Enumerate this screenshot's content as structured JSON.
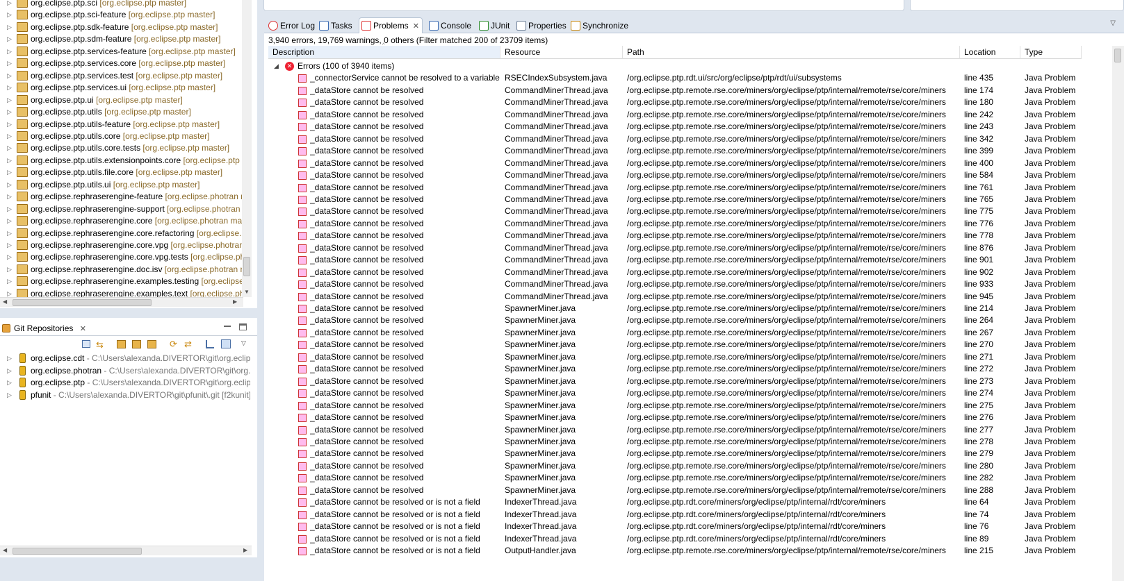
{
  "project_tree": {
    "items": [
      {
        "name": "org.eclipse.ptp.sci",
        "branch": "[org.eclipse.ptp master]"
      },
      {
        "name": "org.eclipse.ptp.sci-feature",
        "branch": "[org.eclipse.ptp master]"
      },
      {
        "name": "org.eclipse.ptp.sdk-feature",
        "branch": "[org.eclipse.ptp master]"
      },
      {
        "name": "org.eclipse.ptp.sdm-feature",
        "branch": "[org.eclipse.ptp master]"
      },
      {
        "name": "org.eclipse.ptp.services-feature",
        "branch": "[org.eclipse.ptp master]"
      },
      {
        "name": "org.eclipse.ptp.services.core",
        "branch": "[org.eclipse.ptp master]"
      },
      {
        "name": "org.eclipse.ptp.services.test",
        "branch": "[org.eclipse.ptp master]"
      },
      {
        "name": "org.eclipse.ptp.services.ui",
        "branch": "[org.eclipse.ptp master]"
      },
      {
        "name": "org.eclipse.ptp.ui",
        "branch": "[org.eclipse.ptp master]"
      },
      {
        "name": "org.eclipse.ptp.utils",
        "branch": "[org.eclipse.ptp master]"
      },
      {
        "name": "org.eclipse.ptp.utils-feature",
        "branch": "[org.eclipse.ptp master]"
      },
      {
        "name": "org.eclipse.ptp.utils.core",
        "branch": "[org.eclipse.ptp master]"
      },
      {
        "name": "org.eclipse.ptp.utils.core.tests",
        "branch": "[org.eclipse.ptp master]"
      },
      {
        "name": "org.eclipse.ptp.utils.extensionpoints.core",
        "branch": "[org.eclipse.ptp m"
      },
      {
        "name": "org.eclipse.ptp.utils.file.core",
        "branch": "[org.eclipse.ptp master]"
      },
      {
        "name": "org.eclipse.ptp.utils.ui",
        "branch": "[org.eclipse.ptp master]"
      },
      {
        "name": "org.eclipse.rephraserengine-feature",
        "branch": "[org.eclipse.photran ma"
      },
      {
        "name": "org.eclipse.rephraserengine-support",
        "branch": "[org.eclipse.photran m"
      },
      {
        "name": "org.eclipse.rephraserengine.core",
        "branch": "[org.eclipse.photran maste"
      },
      {
        "name": "org.eclipse.rephraserengine.core.refactoring",
        "branch": "[org.eclipse.ph"
      },
      {
        "name": "org.eclipse.rephraserengine.core.vpg",
        "branch": "[org.eclipse.photran m"
      },
      {
        "name": "org.eclipse.rephraserengine.core.vpg.tests",
        "branch": "[org.eclipse.phot"
      },
      {
        "name": "org.eclipse.rephraserengine.doc.isv",
        "branch": "[org.eclipse.photran ma"
      },
      {
        "name": "org.eclipse.rephraserengine.examples.testing",
        "branch": "[org.eclipse.pl"
      },
      {
        "name": "org.eclipse.rephraserengine.examples.text",
        "branch": "[org.eclipse.phot"
      }
    ]
  },
  "git_repositories": {
    "title": "Git Repositories",
    "items": [
      {
        "name": "org.eclipse.cdt",
        "path": "- C:\\Users\\alexanda.DIVERTOR\\git\\org.eclipse.c"
      },
      {
        "name": "org.eclipse.photran",
        "path": "- C:\\Users\\alexanda.DIVERTOR\\git\\org.ecli"
      },
      {
        "name": "org.eclipse.ptp",
        "path": "- C:\\Users\\alexanda.DIVERTOR\\git\\org.eclipse.p"
      },
      {
        "name": "pfunit",
        "path": "- C:\\Users\\alexanda.DIVERTOR\\git\\pfunit\\.git [f2kunit]"
      }
    ]
  },
  "tabs": [
    {
      "label": "Error Log",
      "icon": "error-log-icon"
    },
    {
      "label": "Tasks",
      "icon": "tasks-icon"
    },
    {
      "label": "Problems",
      "icon": "problems-icon",
      "active": true
    },
    {
      "label": "Console",
      "icon": "console-icon"
    },
    {
      "label": "JUnit",
      "icon": "junit-icon"
    },
    {
      "label": "Properties",
      "icon": "properties-icon"
    },
    {
      "label": "Synchronize",
      "icon": "synchronize-icon"
    }
  ],
  "problems": {
    "summary": "3,940 errors, 19,769 warnings, 0 others (Filter matched 200 of 23709 items)",
    "columns": {
      "description": "Description",
      "resource": "Resource",
      "path": "Path",
      "location": "Location",
      "type": "Type"
    },
    "group_label": "Errors (100 of 3940 items)",
    "rows": [
      [
        "_connectorService cannot be resolved to a variable",
        "RSECIndexSubsystem.java",
        "/org.eclipse.ptp.rdt.ui/src/org/eclipse/ptp/rdt/ui/subsystems",
        "line 435",
        "Java Problem"
      ],
      [
        "_dataStore cannot be resolved",
        "CommandMinerThread.java",
        "/org.eclipse.ptp.remote.rse.core/miners/org/eclipse/ptp/internal/remote/rse/core/miners",
        "line 174",
        "Java Problem"
      ],
      [
        "_dataStore cannot be resolved",
        "CommandMinerThread.java",
        "/org.eclipse.ptp.remote.rse.core/miners/org/eclipse/ptp/internal/remote/rse/core/miners",
        "line 180",
        "Java Problem"
      ],
      [
        "_dataStore cannot be resolved",
        "CommandMinerThread.java",
        "/org.eclipse.ptp.remote.rse.core/miners/org/eclipse/ptp/internal/remote/rse/core/miners",
        "line 242",
        "Java Problem"
      ],
      [
        "_dataStore cannot be resolved",
        "CommandMinerThread.java",
        "/org.eclipse.ptp.remote.rse.core/miners/org/eclipse/ptp/internal/remote/rse/core/miners",
        "line 243",
        "Java Problem"
      ],
      [
        "_dataStore cannot be resolved",
        "CommandMinerThread.java",
        "/org.eclipse.ptp.remote.rse.core/miners/org/eclipse/ptp/internal/remote/rse/core/miners",
        "line 342",
        "Java Problem"
      ],
      [
        "_dataStore cannot be resolved",
        "CommandMinerThread.java",
        "/org.eclipse.ptp.remote.rse.core/miners/org/eclipse/ptp/internal/remote/rse/core/miners",
        "line 399",
        "Java Problem"
      ],
      [
        "_dataStore cannot be resolved",
        "CommandMinerThread.java",
        "/org.eclipse.ptp.remote.rse.core/miners/org/eclipse/ptp/internal/remote/rse/core/miners",
        "line 400",
        "Java Problem"
      ],
      [
        "_dataStore cannot be resolved",
        "CommandMinerThread.java",
        "/org.eclipse.ptp.remote.rse.core/miners/org/eclipse/ptp/internal/remote/rse/core/miners",
        "line 584",
        "Java Problem"
      ],
      [
        "_dataStore cannot be resolved",
        "CommandMinerThread.java",
        "/org.eclipse.ptp.remote.rse.core/miners/org/eclipse/ptp/internal/remote/rse/core/miners",
        "line 761",
        "Java Problem"
      ],
      [
        "_dataStore cannot be resolved",
        "CommandMinerThread.java",
        "/org.eclipse.ptp.remote.rse.core/miners/org/eclipse/ptp/internal/remote/rse/core/miners",
        "line 765",
        "Java Problem"
      ],
      [
        "_dataStore cannot be resolved",
        "CommandMinerThread.java",
        "/org.eclipse.ptp.remote.rse.core/miners/org/eclipse/ptp/internal/remote/rse/core/miners",
        "line 775",
        "Java Problem"
      ],
      [
        "_dataStore cannot be resolved",
        "CommandMinerThread.java",
        "/org.eclipse.ptp.remote.rse.core/miners/org/eclipse/ptp/internal/remote/rse/core/miners",
        "line 776",
        "Java Problem"
      ],
      [
        "_dataStore cannot be resolved",
        "CommandMinerThread.java",
        "/org.eclipse.ptp.remote.rse.core/miners/org/eclipse/ptp/internal/remote/rse/core/miners",
        "line 778",
        "Java Problem"
      ],
      [
        "_dataStore cannot be resolved",
        "CommandMinerThread.java",
        "/org.eclipse.ptp.remote.rse.core/miners/org/eclipse/ptp/internal/remote/rse/core/miners",
        "line 876",
        "Java Problem"
      ],
      [
        "_dataStore cannot be resolved",
        "CommandMinerThread.java",
        "/org.eclipse.ptp.remote.rse.core/miners/org/eclipse/ptp/internal/remote/rse/core/miners",
        "line 901",
        "Java Problem"
      ],
      [
        "_dataStore cannot be resolved",
        "CommandMinerThread.java",
        "/org.eclipse.ptp.remote.rse.core/miners/org/eclipse/ptp/internal/remote/rse/core/miners",
        "line 902",
        "Java Problem"
      ],
      [
        "_dataStore cannot be resolved",
        "CommandMinerThread.java",
        "/org.eclipse.ptp.remote.rse.core/miners/org/eclipse/ptp/internal/remote/rse/core/miners",
        "line 933",
        "Java Problem"
      ],
      [
        "_dataStore cannot be resolved",
        "CommandMinerThread.java",
        "/org.eclipse.ptp.remote.rse.core/miners/org/eclipse/ptp/internal/remote/rse/core/miners",
        "line 945",
        "Java Problem"
      ],
      [
        "_dataStore cannot be resolved",
        "SpawnerMiner.java",
        "/org.eclipse.ptp.remote.rse.core/miners/org/eclipse/ptp/internal/remote/rse/core/miners",
        "line 214",
        "Java Problem"
      ],
      [
        "_dataStore cannot be resolved",
        "SpawnerMiner.java",
        "/org.eclipse.ptp.remote.rse.core/miners/org/eclipse/ptp/internal/remote/rse/core/miners",
        "line 264",
        "Java Problem"
      ],
      [
        "_dataStore cannot be resolved",
        "SpawnerMiner.java",
        "/org.eclipse.ptp.remote.rse.core/miners/org/eclipse/ptp/internal/remote/rse/core/miners",
        "line 267",
        "Java Problem"
      ],
      [
        "_dataStore cannot be resolved",
        "SpawnerMiner.java",
        "/org.eclipse.ptp.remote.rse.core/miners/org/eclipse/ptp/internal/remote/rse/core/miners",
        "line 270",
        "Java Problem"
      ],
      [
        "_dataStore cannot be resolved",
        "SpawnerMiner.java",
        "/org.eclipse.ptp.remote.rse.core/miners/org/eclipse/ptp/internal/remote/rse/core/miners",
        "line 271",
        "Java Problem"
      ],
      [
        "_dataStore cannot be resolved",
        "SpawnerMiner.java",
        "/org.eclipse.ptp.remote.rse.core/miners/org/eclipse/ptp/internal/remote/rse/core/miners",
        "line 272",
        "Java Problem"
      ],
      [
        "_dataStore cannot be resolved",
        "SpawnerMiner.java",
        "/org.eclipse.ptp.remote.rse.core/miners/org/eclipse/ptp/internal/remote/rse/core/miners",
        "line 273",
        "Java Problem"
      ],
      [
        "_dataStore cannot be resolved",
        "SpawnerMiner.java",
        "/org.eclipse.ptp.remote.rse.core/miners/org/eclipse/ptp/internal/remote/rse/core/miners",
        "line 274",
        "Java Problem"
      ],
      [
        "_dataStore cannot be resolved",
        "SpawnerMiner.java",
        "/org.eclipse.ptp.remote.rse.core/miners/org/eclipse/ptp/internal/remote/rse/core/miners",
        "line 275",
        "Java Problem"
      ],
      [
        "_dataStore cannot be resolved",
        "SpawnerMiner.java",
        "/org.eclipse.ptp.remote.rse.core/miners/org/eclipse/ptp/internal/remote/rse/core/miners",
        "line 276",
        "Java Problem"
      ],
      [
        "_dataStore cannot be resolved",
        "SpawnerMiner.java",
        "/org.eclipse.ptp.remote.rse.core/miners/org/eclipse/ptp/internal/remote/rse/core/miners",
        "line 277",
        "Java Problem"
      ],
      [
        "_dataStore cannot be resolved",
        "SpawnerMiner.java",
        "/org.eclipse.ptp.remote.rse.core/miners/org/eclipse/ptp/internal/remote/rse/core/miners",
        "line 278",
        "Java Problem"
      ],
      [
        "_dataStore cannot be resolved",
        "SpawnerMiner.java",
        "/org.eclipse.ptp.remote.rse.core/miners/org/eclipse/ptp/internal/remote/rse/core/miners",
        "line 279",
        "Java Problem"
      ],
      [
        "_dataStore cannot be resolved",
        "SpawnerMiner.java",
        "/org.eclipse.ptp.remote.rse.core/miners/org/eclipse/ptp/internal/remote/rse/core/miners",
        "line 280",
        "Java Problem"
      ],
      [
        "_dataStore cannot be resolved",
        "SpawnerMiner.java",
        "/org.eclipse.ptp.remote.rse.core/miners/org/eclipse/ptp/internal/remote/rse/core/miners",
        "line 282",
        "Java Problem"
      ],
      [
        "_dataStore cannot be resolved",
        "SpawnerMiner.java",
        "/org.eclipse.ptp.remote.rse.core/miners/org/eclipse/ptp/internal/remote/rse/core/miners",
        "line 288",
        "Java Problem"
      ],
      [
        "_dataStore cannot be resolved or is not a field",
        "IndexerThread.java",
        "/org.eclipse.ptp.rdt.core/miners/org/eclipse/ptp/internal/rdt/core/miners",
        "line 64",
        "Java Problem"
      ],
      [
        "_dataStore cannot be resolved or is not a field",
        "IndexerThread.java",
        "/org.eclipse.ptp.rdt.core/miners/org/eclipse/ptp/internal/rdt/core/miners",
        "line 74",
        "Java Problem"
      ],
      [
        "_dataStore cannot be resolved or is not a field",
        "IndexerThread.java",
        "/org.eclipse.ptp.rdt.core/miners/org/eclipse/ptp/internal/rdt/core/miners",
        "line 76",
        "Java Problem"
      ],
      [
        "_dataStore cannot be resolved or is not a field",
        "IndexerThread.java",
        "/org.eclipse.ptp.rdt.core/miners/org/eclipse/ptp/internal/rdt/core/miners",
        "line 89",
        "Java Problem"
      ],
      [
        "_dataStore cannot be resolved or is not a field",
        "OutputHandler.java",
        "/org.eclipse.ptp.remote.rse.core/miners/org/eclipse/ptp/internal/remote/rse/core/miners",
        "line 215",
        "Java Problem"
      ]
    ]
  }
}
